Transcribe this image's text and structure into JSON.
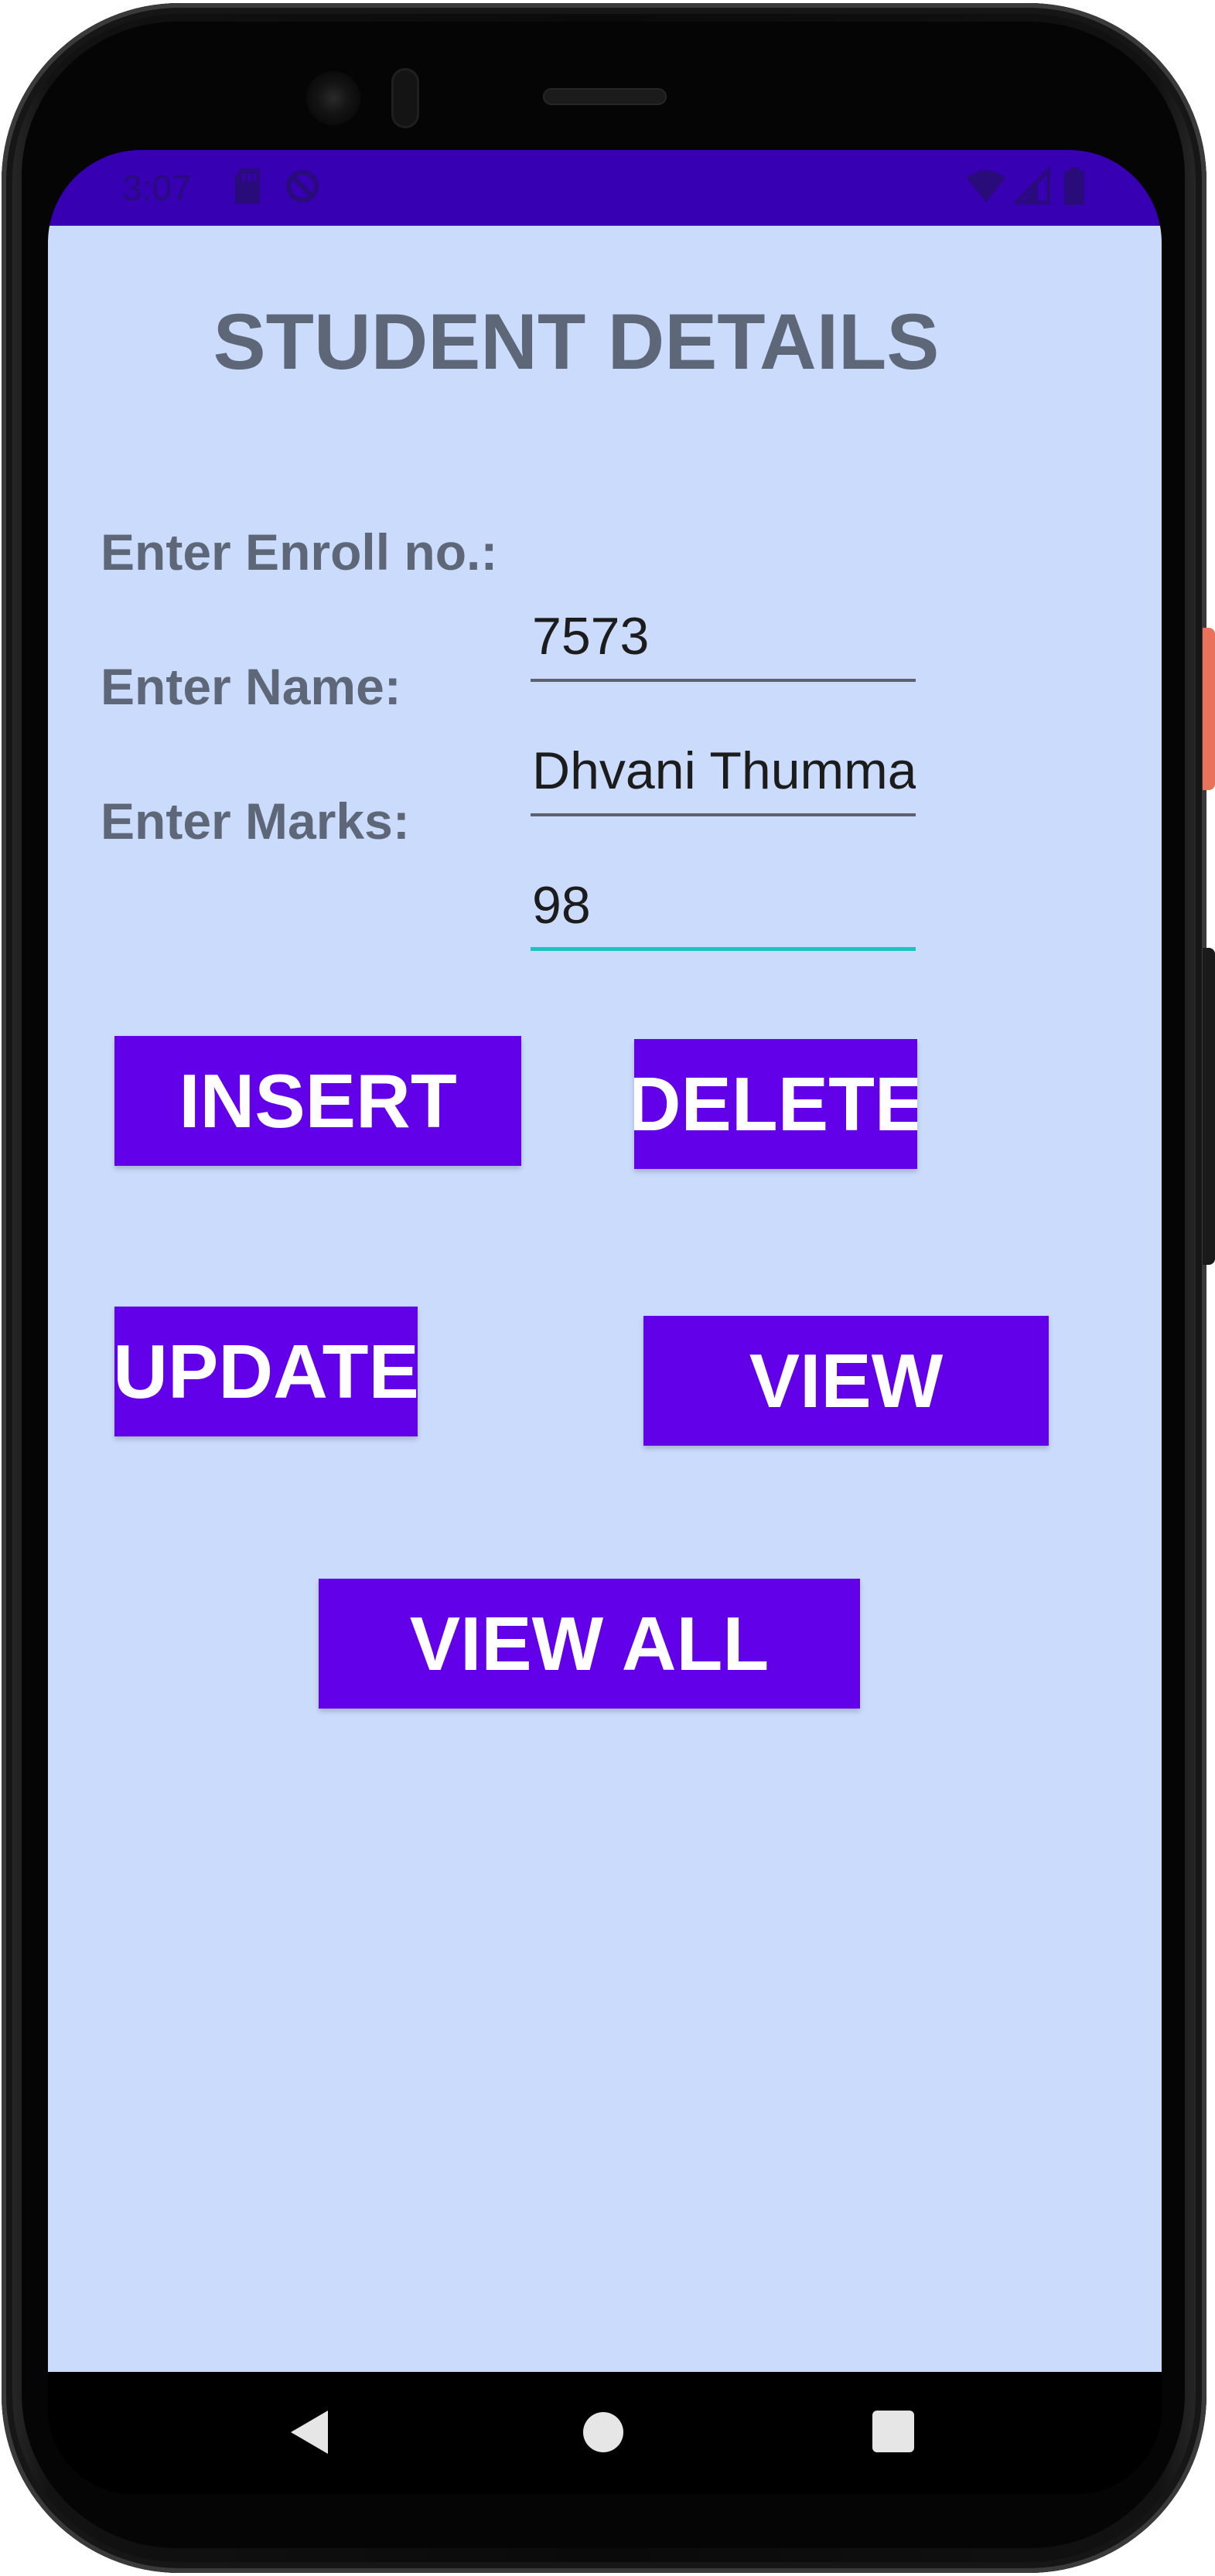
{
  "status_bar": {
    "time": "3:07",
    "icons": [
      "sd-card-icon",
      "sync-icon",
      "wifi-icon",
      "cell-signal-icon",
      "battery-icon"
    ],
    "background": "#3700b3"
  },
  "app": {
    "title": "STUDENT DETAILS",
    "background": "#cbdbfc",
    "form": {
      "enroll": {
        "label": "Enter Enroll no.:",
        "value": "7573"
      },
      "name": {
        "label": "Enter Name:",
        "value": "Dhvani Thummar"
      },
      "marks": {
        "label": "Enter Marks:",
        "value": "98"
      }
    },
    "buttons": {
      "insert": "INSERT",
      "delete": "DELETE",
      "update": "UPDATE",
      "view": "VIEW",
      "view_all": "VIEW ALL"
    },
    "colors": {
      "button": "#6200ea",
      "label": "#5d6777",
      "focus_underline": "#18c5c0"
    }
  },
  "nav_bar": {
    "icons": [
      "back-icon",
      "home-icon",
      "recents-icon"
    ]
  }
}
